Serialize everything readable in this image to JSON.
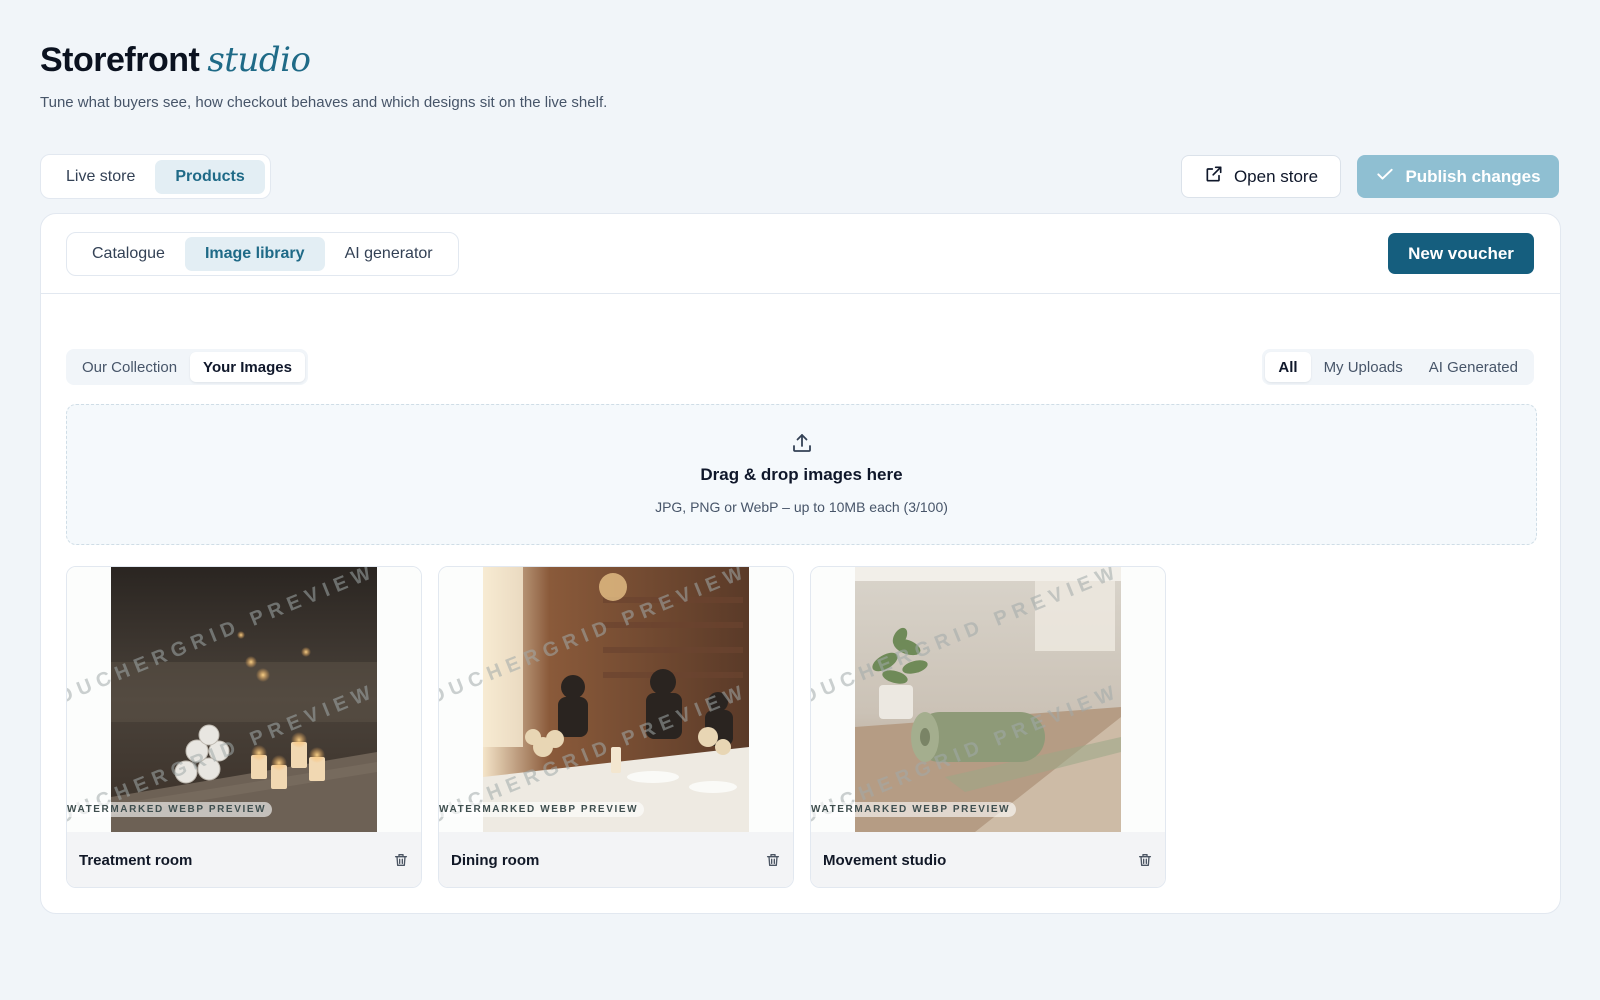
{
  "header": {
    "title": "Storefront",
    "title_accent": "studio",
    "subtitle": "Tune what buyers see, how checkout behaves and which designs sit on the live shelf."
  },
  "top_tabs": [
    {
      "label": "Live store",
      "active": false
    },
    {
      "label": "Products",
      "active": true
    }
  ],
  "actions": {
    "open_store": "Open store",
    "publish": "Publish changes",
    "new_voucher": "New voucher"
  },
  "sub_tabs": [
    {
      "label": "Catalogue",
      "active": false
    },
    {
      "label": "Image library",
      "active": true
    },
    {
      "label": "AI generator",
      "active": false
    }
  ],
  "source_toggle": [
    {
      "label": "Our Collection",
      "active": false
    },
    {
      "label": "Your Images",
      "active": true
    }
  ],
  "filters": [
    {
      "label": "All",
      "active": true
    },
    {
      "label": "My Uploads",
      "active": false
    },
    {
      "label": "AI Generated",
      "active": false
    }
  ],
  "dropzone": {
    "title": "Drag & drop images here",
    "hint": "JPG, PNG or WebP – up to 10MB each (3/100)"
  },
  "watermark": {
    "text": "VOUCHERGRID PREVIEW",
    "badge": "WATERMARKED WEBP PREVIEW"
  },
  "images": [
    {
      "name": "Treatment room"
    },
    {
      "name": "Dining room"
    },
    {
      "name": "Movement studio"
    }
  ],
  "colors": {
    "accent": "#1f6a87",
    "primary_button": "#155e7e",
    "publish_disabled": "#8fbfd2",
    "background": "#f1f5f9"
  },
  "icons": {
    "open_store": "external-link-icon",
    "publish": "check-icon",
    "upload": "upload-icon",
    "delete": "trash-icon"
  }
}
